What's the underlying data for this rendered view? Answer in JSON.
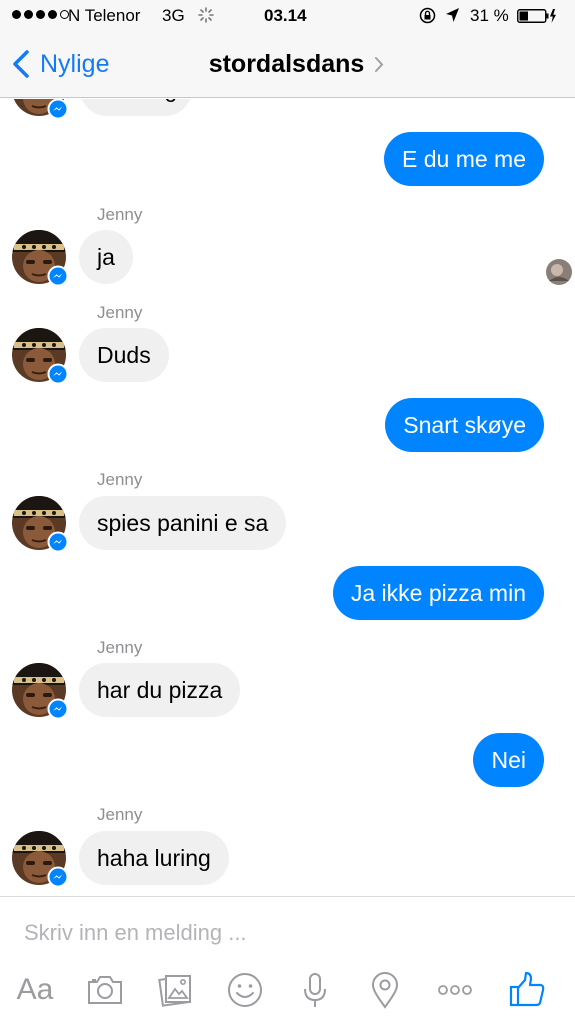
{
  "status_bar": {
    "carrier": "N Telenor",
    "network": "3G",
    "time": "03.14",
    "battery": "31 %"
  },
  "nav": {
    "back_label": "Nylige",
    "title": "stordalsdans"
  },
  "messages": {
    "partial_text": "wanting",
    "sender_name": "Jenny",
    "items": [
      {
        "direction": "out",
        "text": "E du me me"
      },
      {
        "direction": "in",
        "sender": "Jenny",
        "text": "ja"
      },
      {
        "direction": "in",
        "sender": "Jenny",
        "text": "Duds"
      },
      {
        "direction": "out",
        "text": "Snart skøye"
      },
      {
        "direction": "in",
        "sender": "Jenny",
        "text": "spies panini e sa"
      },
      {
        "direction": "out",
        "text": "Ja ikke pizza min"
      },
      {
        "direction": "in",
        "sender": "Jenny",
        "text": "har du pizza"
      },
      {
        "direction": "out",
        "text": "Nei"
      },
      {
        "direction": "in",
        "sender": "Jenny",
        "text": "haha luring"
      }
    ]
  },
  "composer": {
    "placeholder": "Skriv inn en melding ...",
    "aa_label": "Aa"
  },
  "icons": [
    "signal-icon",
    "loading-spinner-icon",
    "rotation-lock-icon",
    "location-arrow-icon",
    "battery-icon",
    "back-chevron-icon",
    "chevron-right-icon",
    "messenger-badge-icon",
    "camera-icon",
    "photo-gallery-icon",
    "emoji-icon",
    "microphone-icon",
    "location-pin-icon",
    "more-icon",
    "thumbs-up-icon"
  ],
  "colors": {
    "accent": "#0084ff",
    "nav_link": "#137cf5",
    "incoming_bubble": "#f1f0f0",
    "toolbar_icon": "#9b9ba0"
  }
}
